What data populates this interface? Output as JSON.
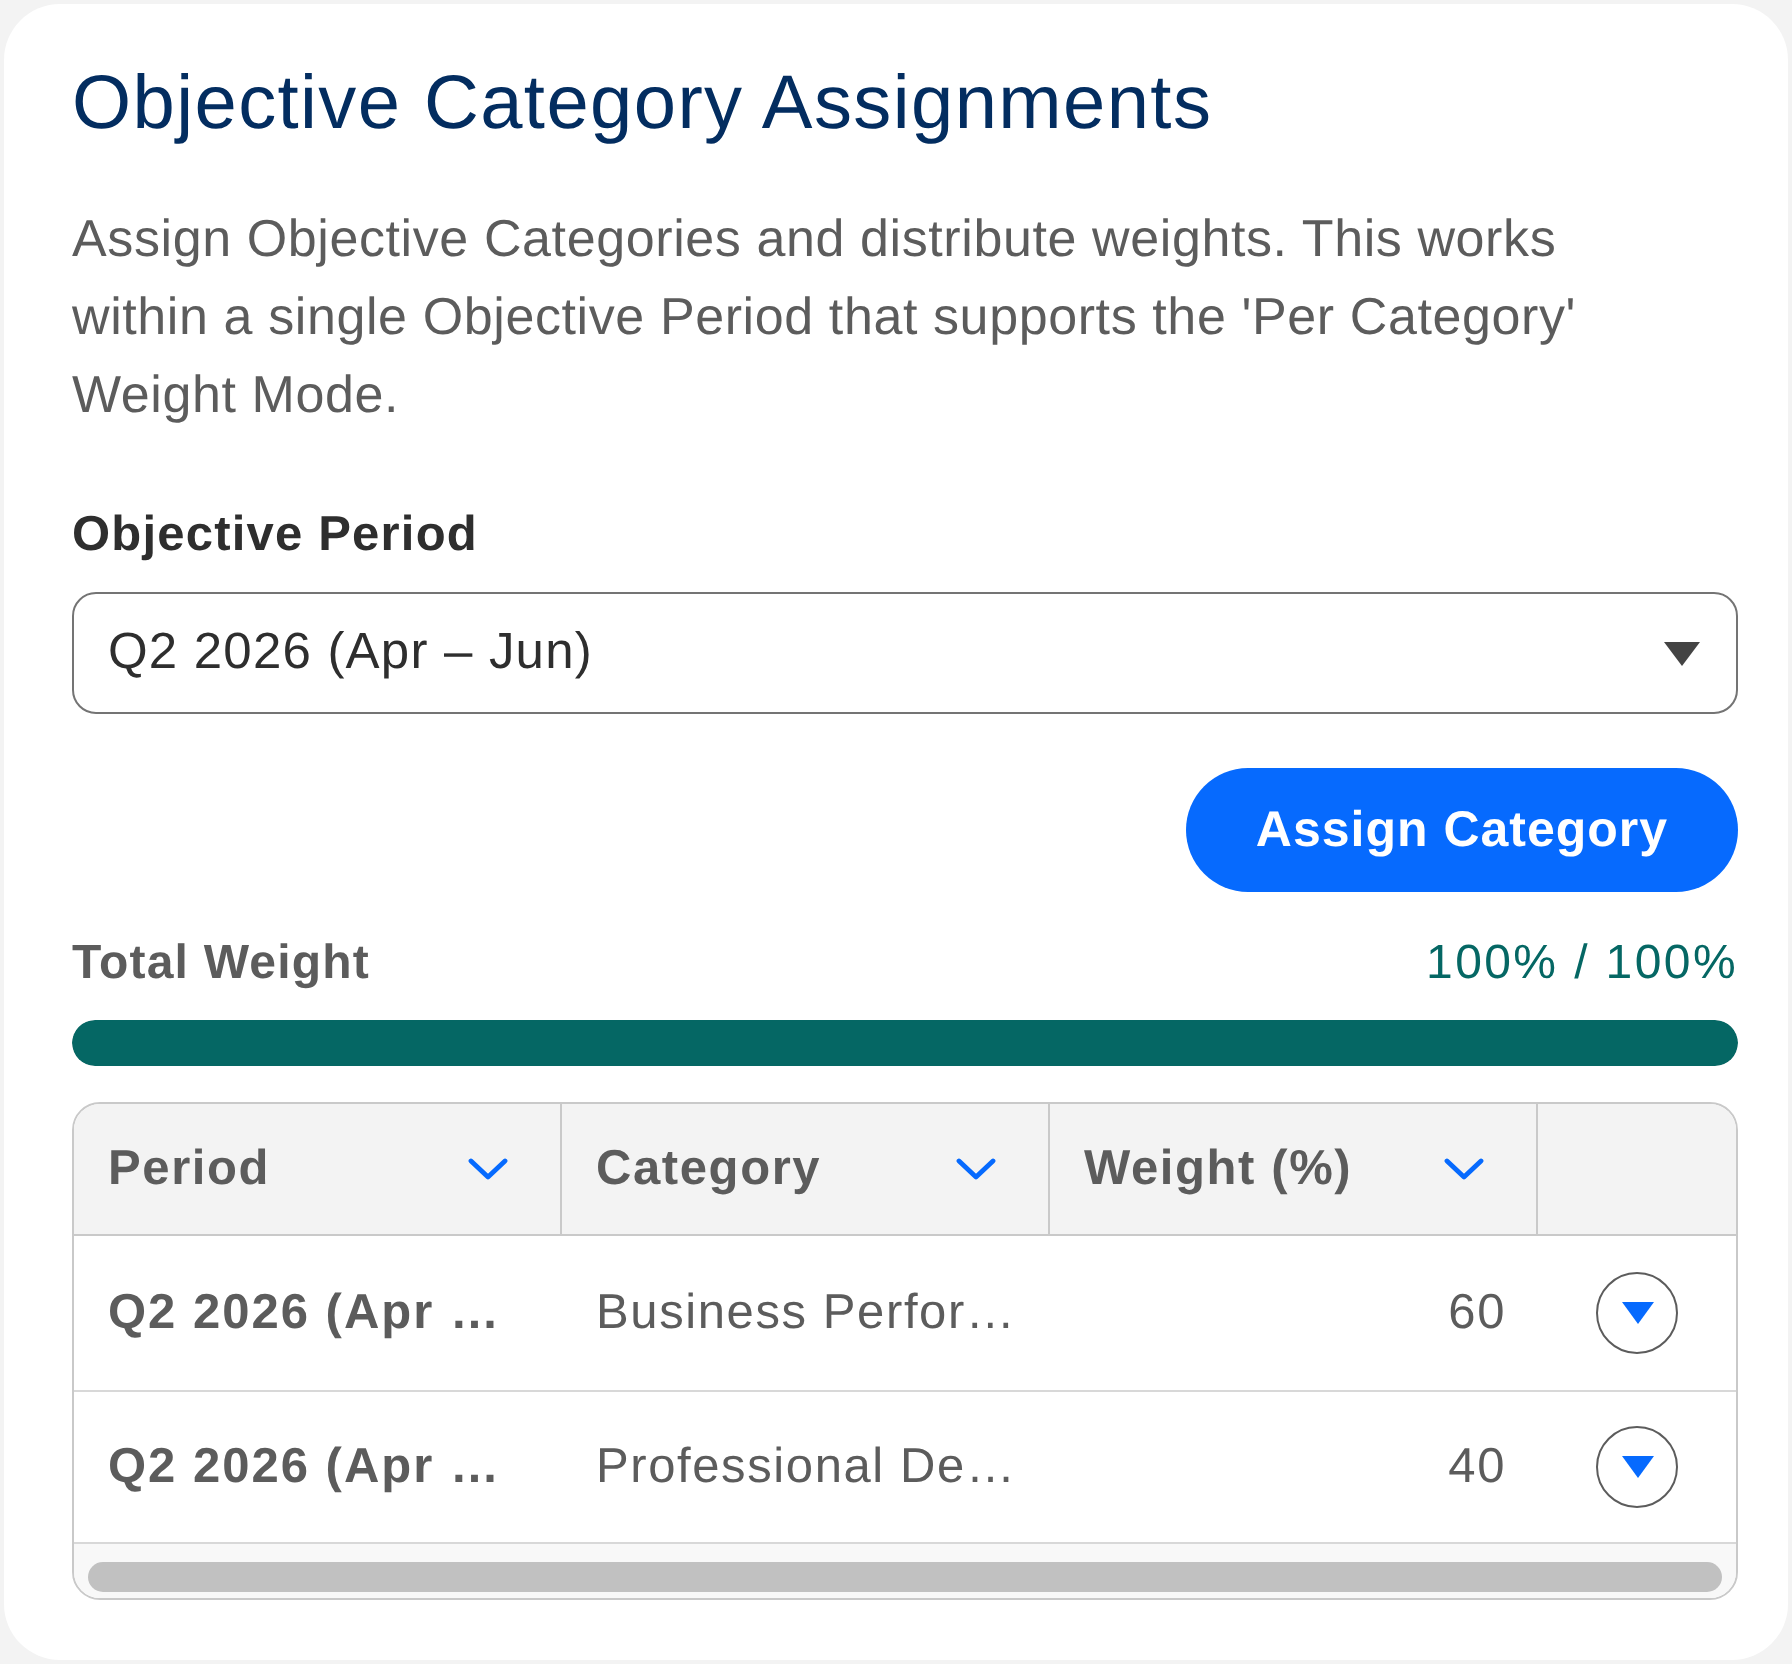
{
  "card": {
    "title": "Objective Category Assignments",
    "description": "Assign Objective Categories and distribute weights. This works within a single Objective Period that supports the 'Per Category' Weight Mode."
  },
  "period_field": {
    "label": "Objective Period",
    "value": "Q2 2026 (Apr – Jun)"
  },
  "assign_button": {
    "label": "Assign Category"
  },
  "total_weight": {
    "label": "Total Weight",
    "reading": "100% / 100%",
    "level": 1
  },
  "table": {
    "columns": [
      {
        "label": "Period"
      },
      {
        "label": "Category"
      },
      {
        "label": "Weight (%)"
      }
    ],
    "rows": [
      {
        "period": "Q2 2026 (Apr …",
        "category": "Business Perfor…",
        "weight": "60"
      },
      {
        "period": "Q2 2026 (Apr …",
        "category": "Professional De…",
        "weight": "40"
      }
    ]
  }
}
